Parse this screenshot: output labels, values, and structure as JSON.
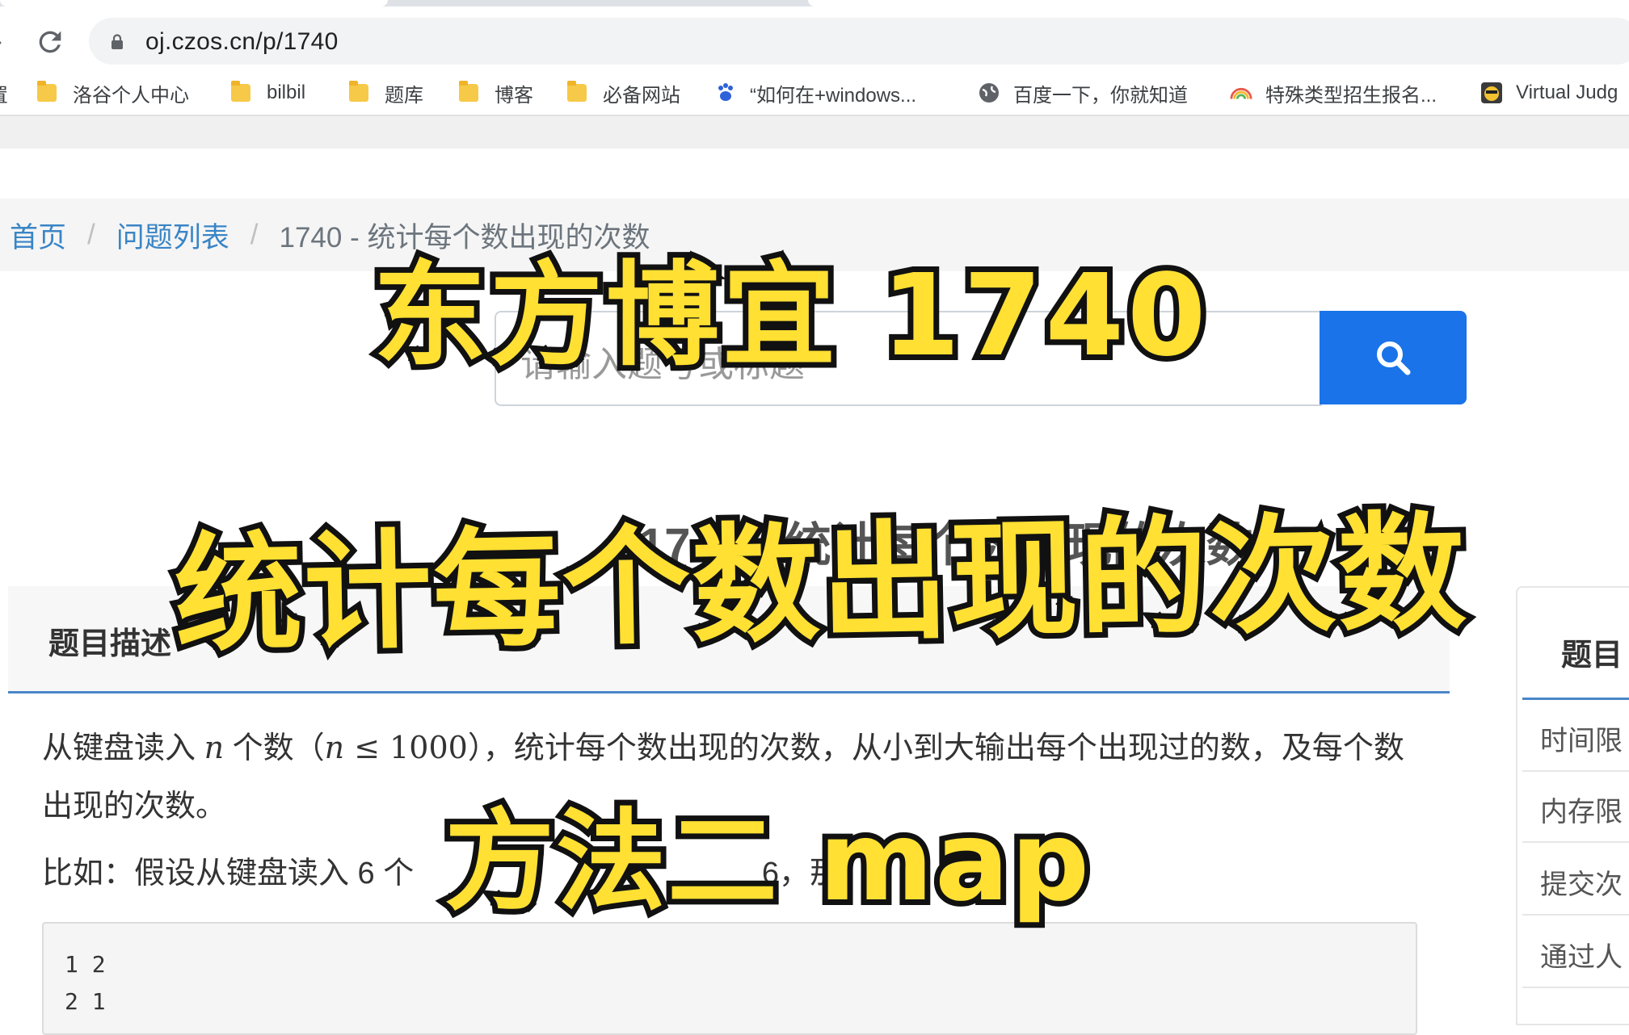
{
  "browser": {
    "url": "oj.czos.cn/p/1740",
    "bookmarks": [
      {
        "label": "洛谷个人中心",
        "icon": "folder-icon"
      },
      {
        "label": "bilbil",
        "icon": "folder-icon"
      },
      {
        "label": "题库",
        "icon": "folder-icon"
      },
      {
        "label": "博客",
        "icon": "folder-icon"
      },
      {
        "label": "必备网站",
        "icon": "folder-icon"
      },
      {
        "label": "“如何在+windows...",
        "icon": "baidu-paw-icon"
      },
      {
        "label": "百度一下，你就知道",
        "icon": "globe-icon"
      },
      {
        "label": "特殊类型招生报名...",
        "icon": "rainbow-icon"
      },
      {
        "label": "Virtual Judg",
        "icon": "vjudge-icon"
      }
    ]
  },
  "breadcrumb": {
    "home": "首页",
    "list": "问题列表",
    "current": "1740 - 统计每个数出现的次数"
  },
  "search": {
    "placeholder": "请输入题号或标题"
  },
  "problem": {
    "title": "1740 - 统计每个数出现的次数",
    "panel_heading": "题目描述",
    "desc_pre": "从键盘读入",
    "desc_var_n": "n",
    "desc_mid1": "个数（",
    "desc_cond_n": "n",
    "desc_cond_le": " ≤ 1000",
    "desc_post": "），统计每个数出现的次数，从小到大输出每个出现过的数，及每个数出现的次数。",
    "example_intro": "比如：假设从键盘读入 6 个",
    "example_tail": "6，那",
    "code_lines": [
      "1 2",
      "2 1"
    ]
  },
  "sidebar": {
    "heading": "题目",
    "rows": [
      "时间限",
      "内存限",
      "提交次",
      "通过人"
    ]
  },
  "overlay": {
    "line1": "东方博宜 1740",
    "line2": "统计每个数出现的次数",
    "line3": "方法二 map"
  },
  "colors": {
    "accent_blue": "#1a73e8",
    "link_blue": "#3a85c6",
    "caption_yellow": "#ffe033"
  }
}
